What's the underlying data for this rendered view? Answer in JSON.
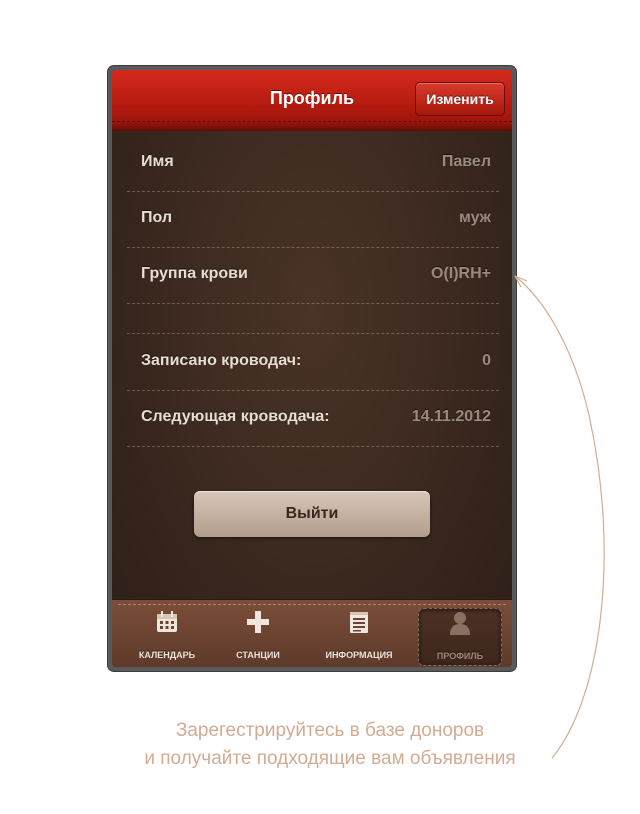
{
  "navbar": {
    "title": "Профиль",
    "edit_label": "Изменить"
  },
  "profile_rows": [
    {
      "label": "Имя",
      "value": "Павел"
    },
    {
      "label": "Пол",
      "value": "муж"
    },
    {
      "label": "Группа крови",
      "value": "O(I)RH+"
    },
    {
      "label": "",
      "value": ""
    },
    {
      "label": "Записано кроводач:",
      "value": "0"
    },
    {
      "label": "Следующая кроводача:",
      "value": "14.11.2012"
    }
  ],
  "logout_label": "Выйти",
  "tabs": [
    {
      "label": "КАЛЕНДАРЬ",
      "icon": "calendar-icon",
      "selected": false
    },
    {
      "label": "СТАНЦИИ",
      "icon": "plus-icon",
      "selected": false
    },
    {
      "label": "ИНФОРМАЦИЯ",
      "icon": "document-icon",
      "selected": false
    },
    {
      "label": "ПРОФИЛЬ",
      "icon": "person-icon",
      "selected": true
    }
  ],
  "caption": {
    "line1": "Зарегестрируйтесь в базе доноров",
    "line2": "и получайте подходящие вам объявления"
  },
  "colors": {
    "navbar_red": "#c3221a",
    "caption": "#d3ab92",
    "background": "#3a281f"
  }
}
